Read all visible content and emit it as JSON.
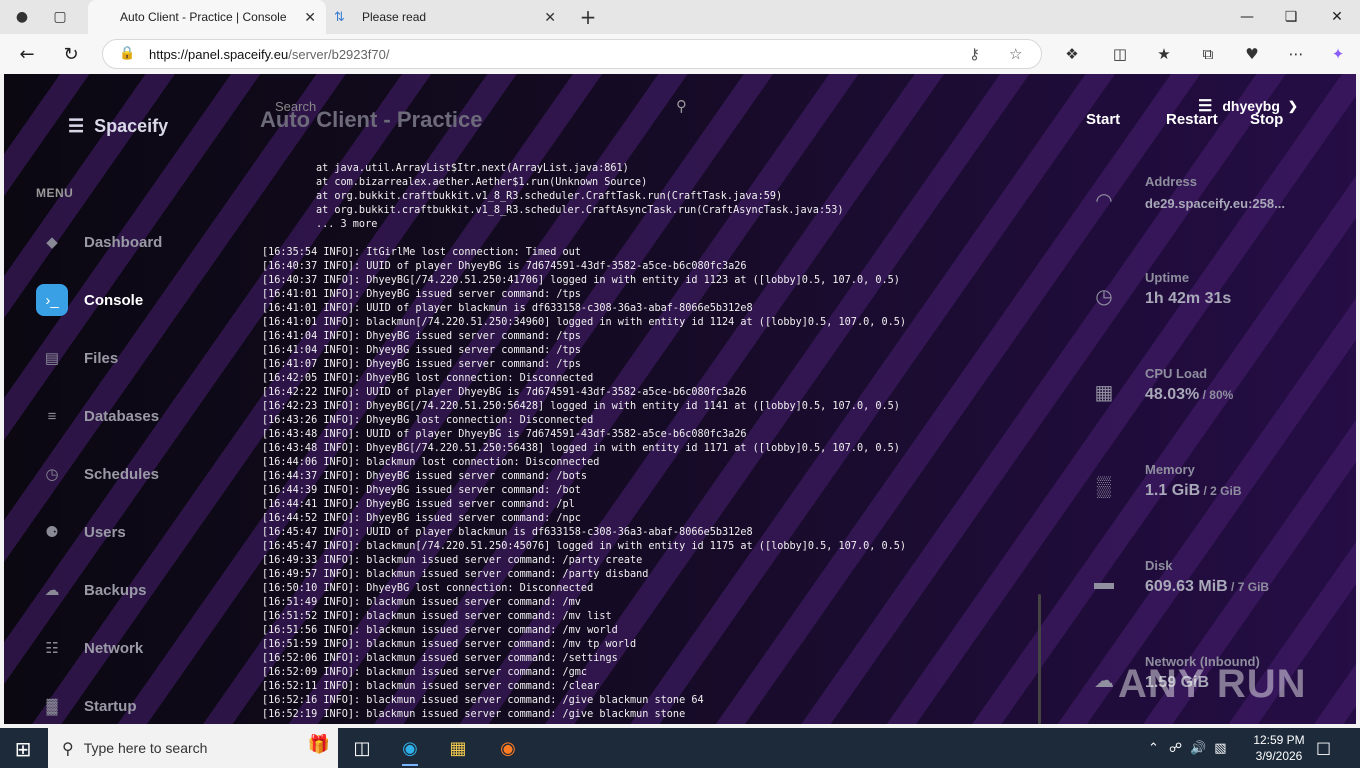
{
  "browser": {
    "tabs": [
      {
        "label": "Auto Client - Practice | Console",
        "active": true
      },
      {
        "label": "Please read",
        "active": false
      }
    ],
    "url_domain": "https://panel.spaceify.eu",
    "url_path": "/server/b2923f70/"
  },
  "panel": {
    "brand": "Spaceify",
    "search_label": "Search",
    "server_title": "Auto Client - Practice",
    "buttons": {
      "start": "Start",
      "restart": "Restart",
      "stop": "Stop"
    },
    "username": "dhyeybg",
    "menu_heading": "MENU",
    "nav": [
      {
        "label": "Dashboard",
        "icon": "layers-icon",
        "active": false
      },
      {
        "label": "Console",
        "icon": "terminal-icon",
        "active": true
      },
      {
        "label": "Files",
        "icon": "file-icon",
        "active": false
      },
      {
        "label": "Databases",
        "icon": "database-icon",
        "active": false
      },
      {
        "label": "Schedules",
        "icon": "clock-icon",
        "active": false
      },
      {
        "label": "Users",
        "icon": "users-icon",
        "active": false
      },
      {
        "label": "Backups",
        "icon": "cloud-icon",
        "active": false
      },
      {
        "label": "Network",
        "icon": "network-icon",
        "active": false
      },
      {
        "label": "Startup",
        "icon": "chart-icon",
        "active": false
      }
    ],
    "stats": [
      {
        "label": "Address",
        "value": "de29.spaceify.eu:258...",
        "max": "",
        "icon": "wifi-icon"
      },
      {
        "label": "Uptime",
        "value": "1h 42m 31s",
        "max": "",
        "icon": "clock-icon"
      },
      {
        "label": "CPU Load",
        "value": "48.03%",
        "max": " / 80%",
        "icon": "cpu-icon"
      },
      {
        "label": "Memory",
        "value": "1.1 GiB",
        "max": " / 2 GiB",
        "icon": "memory-icon"
      },
      {
        "label": "Disk",
        "value": "609.63 MiB",
        "max": " / 7 GiB",
        "icon": "disk-icon"
      },
      {
        "label": "Network (Inbound)",
        "value": "1.59 GiB",
        "max": "",
        "icon": "cloud-download-icon"
      }
    ]
  },
  "console": {
    "trace": [
      "at java.util.ArrayList$Itr.next(ArrayList.java:861)",
      "at com.bizarrealex.aether.Aether$1.run(Unknown Source)",
      "at org.bukkit.craftbukkit.v1_8_R3.scheduler.CraftTask.run(CraftTask.java:59)",
      "at org.bukkit.craftbukkit.v1_8_R3.scheduler.CraftAsyncTask.run(CraftAsyncTask.java:53)",
      "... 3 more"
    ],
    "lines": [
      "[16:35:54 INFO]: ItGirlMe lost connection: Timed out",
      "[16:40:37 INFO]: UUID of player DhyeyBG is 7d674591-43df-3582-a5ce-b6c080fc3a26",
      "[16:40:37 INFO]: DhyeyBG[/74.220.51.250:41706] logged in with entity id 1123 at ([lobby]0.5, 107.0, 0.5)",
      "[16:41:01 INFO]: DhyeyBG issued server command: /tps",
      "[16:41:01 INFO]: UUID of player blackmun is df633158-c308-36a3-abaf-8066e5b312e8",
      "[16:41:01 INFO]: blackmun[/74.220.51.250:34960] logged in with entity id 1124 at ([lobby]0.5, 107.0, 0.5)",
      "[16:41:04 INFO]: DhyeyBG issued server command: /tps",
      "[16:41:04 INFO]: DhyeyBG issued server command: /tps",
      "[16:41:07 INFO]: DhyeyBG issued server command: /tps",
      "[16:42:05 INFO]: DhyeyBG lost connection: Disconnected",
      "[16:42:22 INFO]: UUID of player DhyeyBG is 7d674591-43df-3582-a5ce-b6c080fc3a26",
      "[16:42:23 INFO]: DhyeyBG[/74.220.51.250:56428] logged in with entity id 1141 at ([lobby]0.5, 107.0, 0.5)",
      "[16:43:26 INFO]: DhyeyBG lost connection: Disconnected",
      "[16:43:48 INFO]: UUID of player DhyeyBG is 7d674591-43df-3582-a5ce-b6c080fc3a26",
      "[16:43:48 INFO]: DhyeyBG[/74.220.51.250:56438] logged in with entity id 1171 at ([lobby]0.5, 107.0, 0.5)",
      "[16:44:06 INFO]: blackmun lost connection: Disconnected",
      "[16:44:37 INFO]: DhyeyBG issued server command: /bots",
      "[16:44:39 INFO]: DhyeyBG issued server command: /bot",
      "[16:44:41 INFO]: DhyeyBG issued server command: /pl",
      "[16:44:52 INFO]: DhyeyBG issued server command: /npc",
      "[16:45:47 INFO]: UUID of player blackmun is df633158-c308-36a3-abaf-8066e5b312e8",
      "[16:45:47 INFO]: blackmun[/74.220.51.250:45076] logged in with entity id 1175 at ([lobby]0.5, 107.0, 0.5)",
      "[16:49:33 INFO]: blackmun issued server command: /party create",
      "[16:49:57 INFO]: blackmun issued server command: /party disband",
      "[16:50:10 INFO]: DhyeyBG lost connection: Disconnected",
      "[16:51:49 INFO]: blackmun issued server command: /mv",
      "[16:51:52 INFO]: blackmun issued server command: /mv list",
      "[16:51:56 INFO]: blackmun issued server command: /mv world",
      "[16:51:59 INFO]: blackmun issued server command: /mv tp world",
      "[16:52:06 INFO]: blackmun issued server command: /settings",
      "[16:52:09 INFO]: blackmun issued server command: /gmc",
      "[16:52:11 INFO]: blackmun issued server command: /clear",
      "[16:52:16 INFO]: blackmun issued server command: /give blackmun stone 64",
      "[16:52:19 INFO]: blackmun issued server command: /give blackmun stone"
    ]
  },
  "watermark": "ANY RUN",
  "taskbar": {
    "search_placeholder": "Type here to search",
    "time": "12:59 PM",
    "date": "3/9/2026"
  }
}
